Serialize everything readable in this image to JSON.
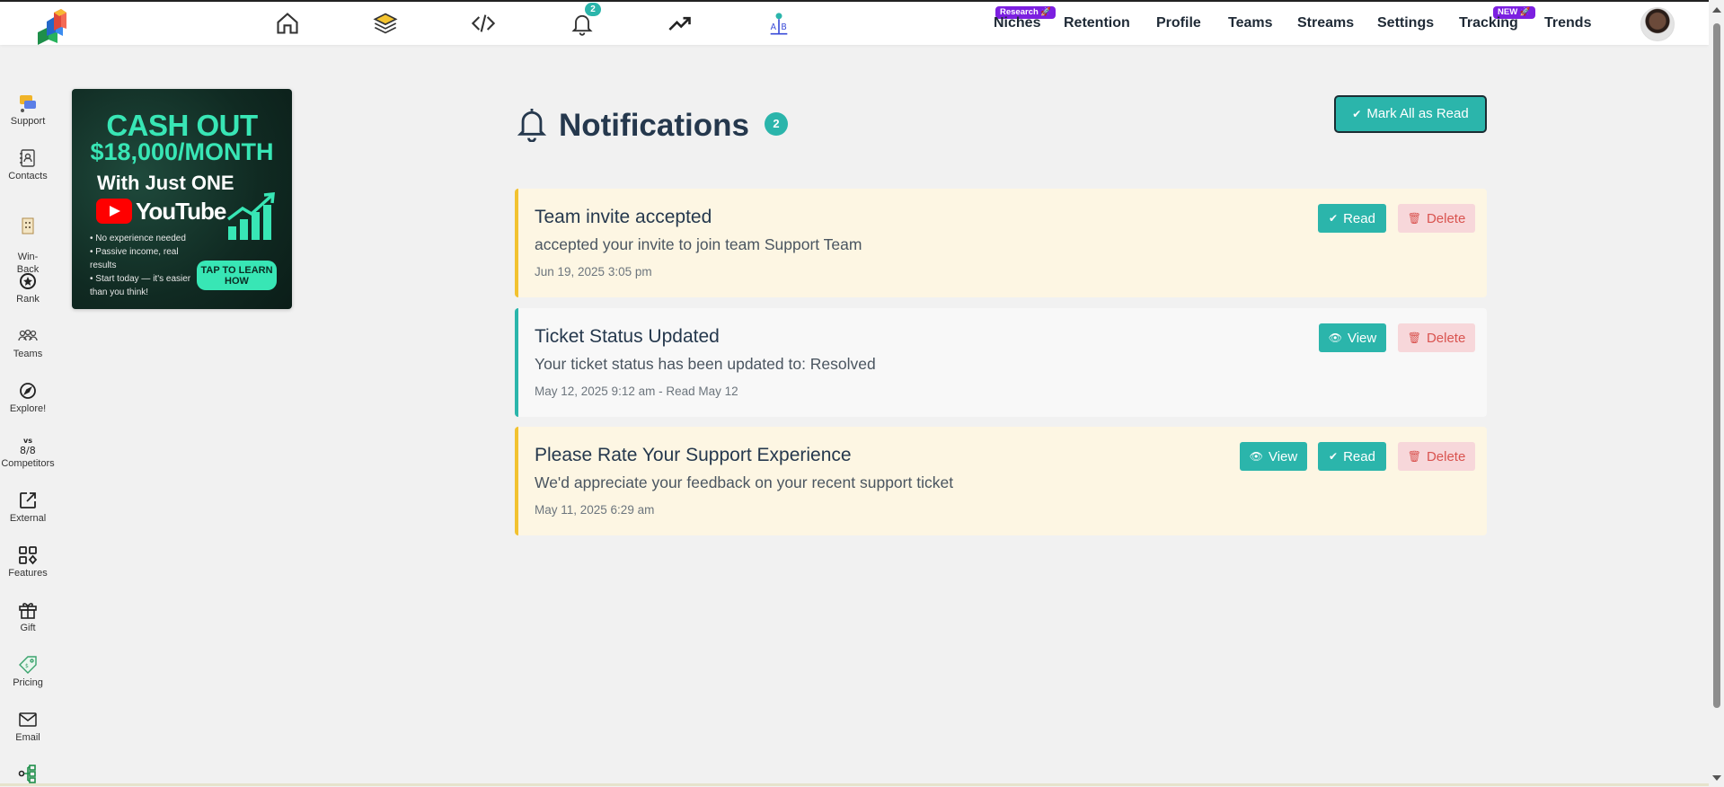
{
  "header": {
    "nav": {
      "niches": "Niches",
      "niches_pill": "Research 🚀",
      "retention": "Retention",
      "profile": "Profile",
      "teams": "Teams",
      "streams": "Streams",
      "settings": "Settings",
      "tracking": "Tracking",
      "tracking_pill": "NEW 🚀",
      "trends": "Trends"
    },
    "notification_count": "2",
    "icons": [
      "home-icon",
      "layers-icon",
      "code-icon",
      "bell-icon",
      "trending-up-icon",
      "ab-test-icon"
    ]
  },
  "sidebar": {
    "items": [
      {
        "label": "Support",
        "icon": "support-chat-icon"
      },
      {
        "label": "Contacts",
        "icon": "contacts-book-icon"
      },
      {
        "label": "Win-\nBack",
        "icon": "win-back-icon"
      },
      {
        "label": "Rank",
        "icon": "rank-star-icon"
      },
      {
        "label": "Teams",
        "icon": "teams-icon"
      },
      {
        "label": "Explore!",
        "icon": "compass-icon"
      },
      {
        "label": "Competitors",
        "icon": "versus-icon"
      },
      {
        "label": "External",
        "icon": "external-link-icon"
      },
      {
        "label": "Features",
        "icon": "grid-icon"
      },
      {
        "label": "Gift",
        "icon": "gift-icon"
      },
      {
        "label": "Pricing",
        "icon": "price-tag-icon"
      },
      {
        "label": "Email",
        "icon": "envelope-icon"
      }
    ]
  },
  "ad": {
    "line1": "CASH OUT",
    "line2": "$18,000/MONTH",
    "line3": "With Just ONE",
    "youtube": "YouTube",
    "bullets": [
      "No experience needed",
      "Passive income, real results",
      "Start today — it's easier than you think!"
    ],
    "cta": "TAP TO LEARN HOW"
  },
  "page": {
    "title": "Notifications",
    "badge": "2",
    "mark_all": "Mark All as Read"
  },
  "notifications": [
    {
      "title": "Team invite accepted",
      "body": "accepted your invite to join team Support Team",
      "time": "Jun 19, 2025 3:05 pm",
      "status": "unread",
      "actions": {
        "read": "Read",
        "delete": "Delete"
      }
    },
    {
      "title": "Ticket Status Updated",
      "body": "Your ticket status has been updated to: Resolved",
      "time": "May 12, 2025 9:12 am - Read May 12",
      "status": "read",
      "actions": {
        "view": "View",
        "delete": "Delete"
      }
    },
    {
      "title": "Please Rate Your Support Experience",
      "body": "We'd appreciate your feedback on your recent support ticket",
      "time": "May 11, 2025 6:29 am",
      "status": "unread",
      "actions": {
        "view": "View",
        "read": "Read",
        "delete": "Delete"
      }
    }
  ],
  "colors": {
    "accent": "#2bb5ab",
    "unread_bg": "#fdf6e3",
    "unread_border": "#f2c230",
    "delete_bg": "#f7d7da",
    "delete_text": "#d9534f",
    "pill": "#7c1fe0"
  }
}
